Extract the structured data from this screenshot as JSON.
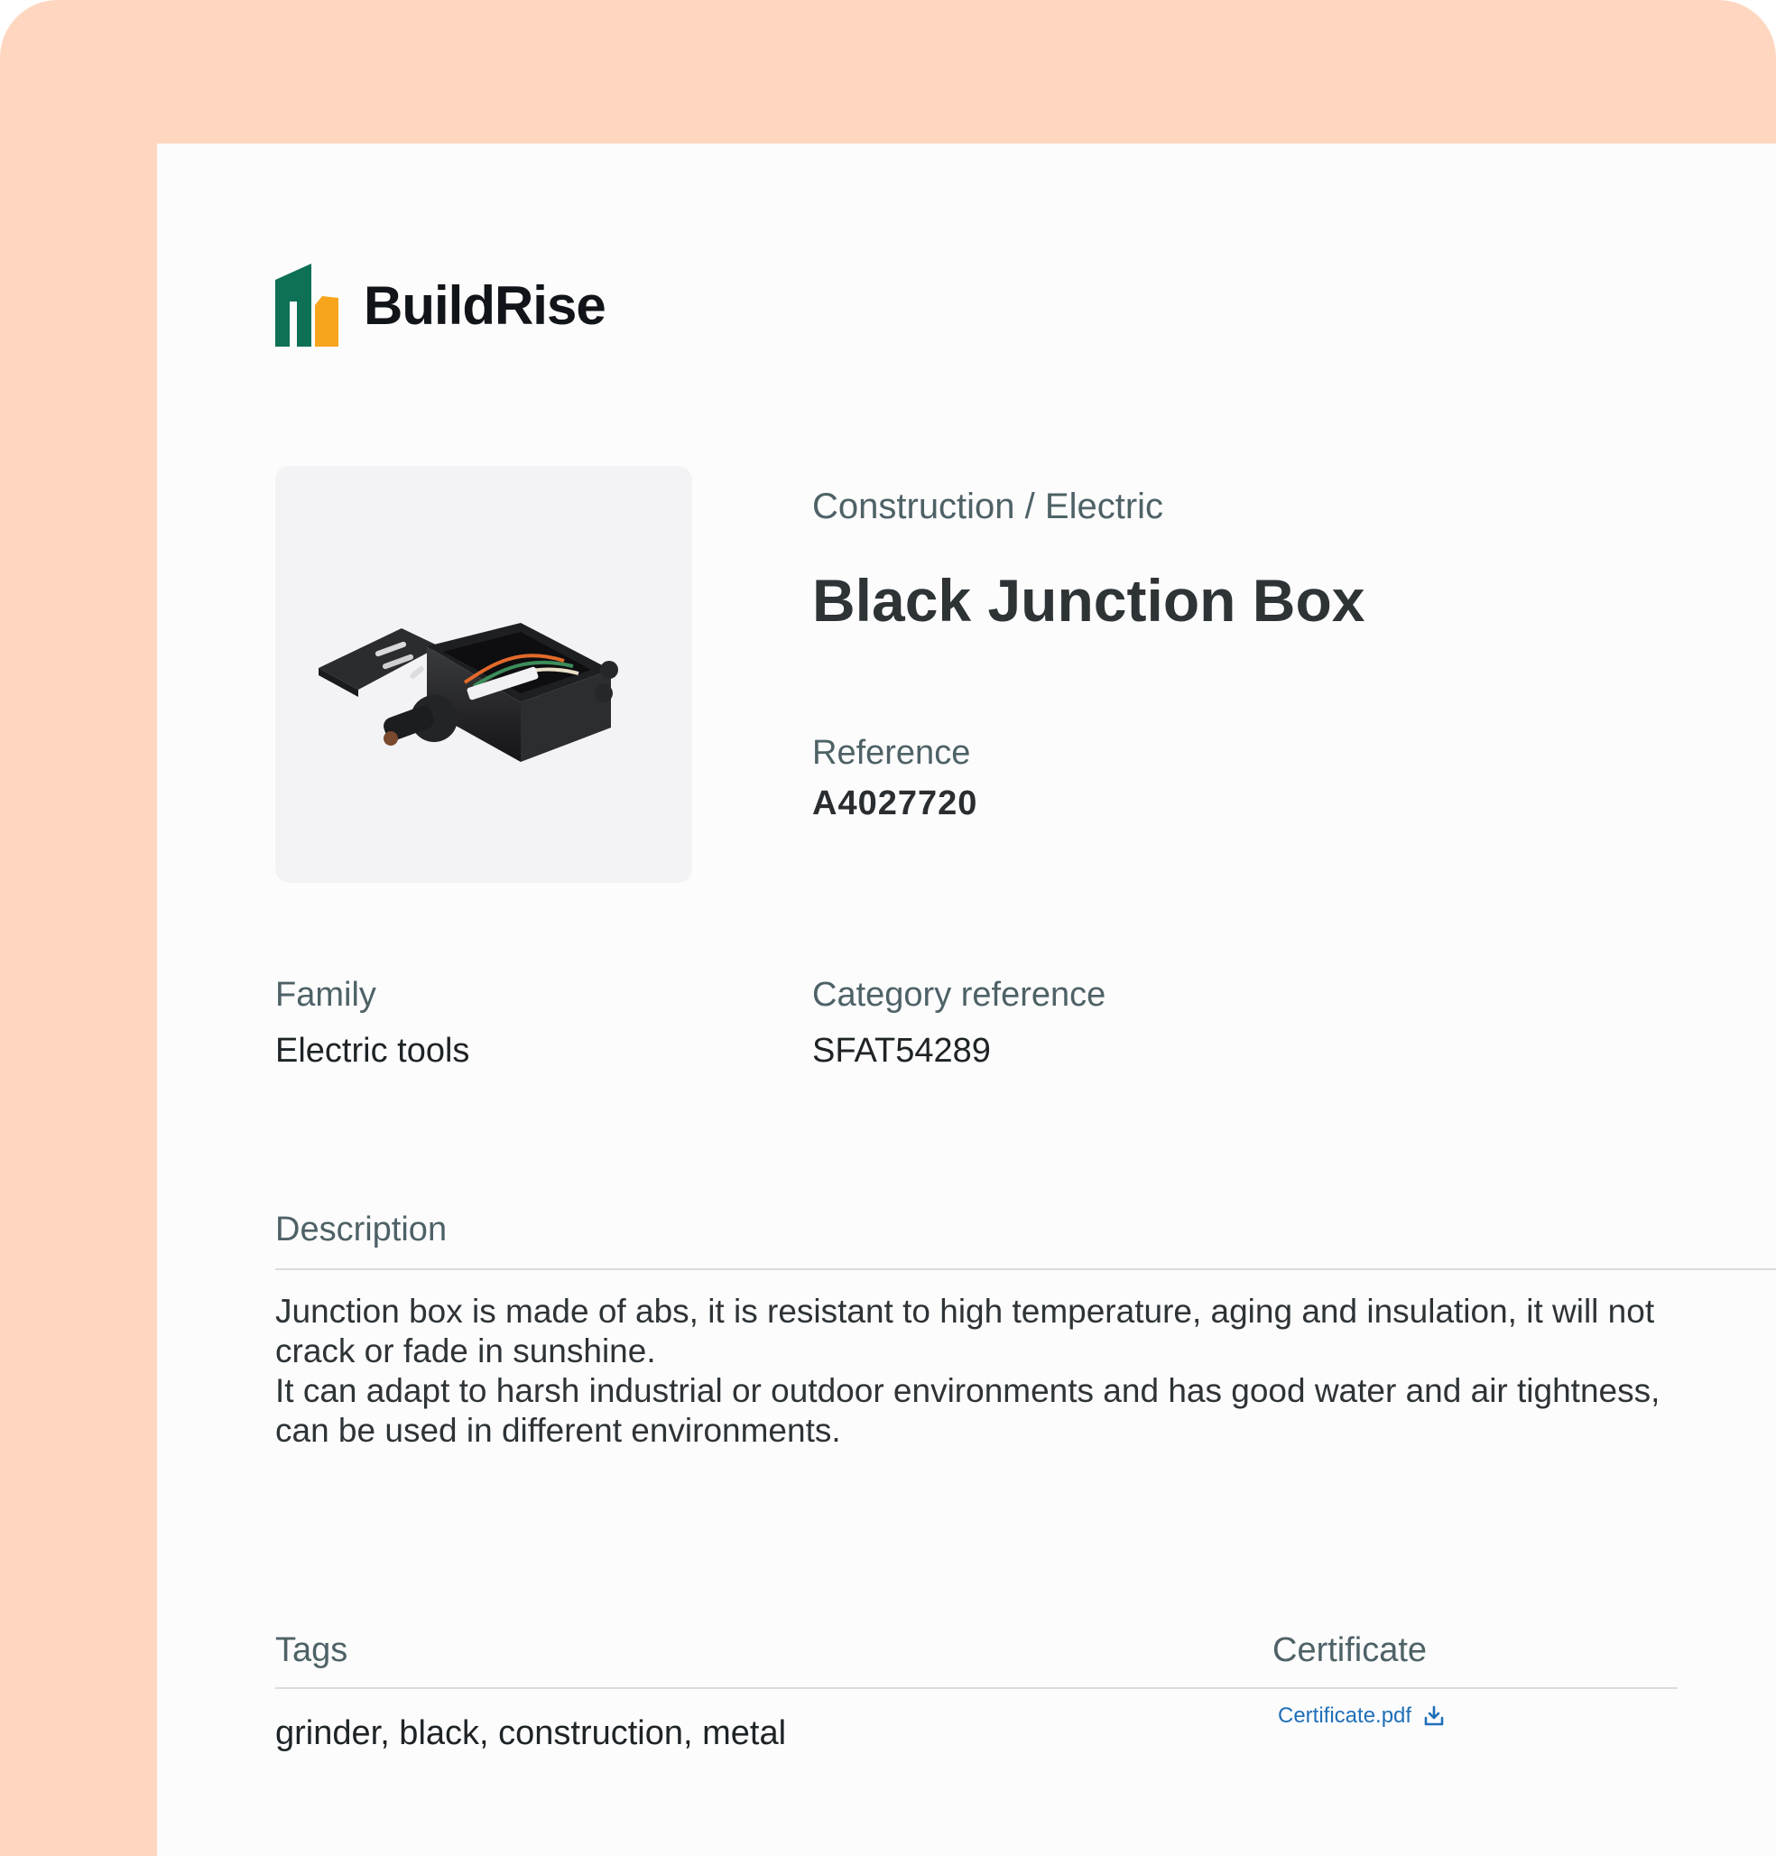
{
  "brand": {
    "name": "BuildRise",
    "colors": {
      "primary": "#0E7156",
      "accent": "#F7A51C",
      "frame": "#FFD6BF"
    },
    "icon": "buildrise-logo-icon"
  },
  "product": {
    "breadcrumb": "Construction / Electric",
    "title": "Black Junction Box",
    "image_icon": "junction-box-image",
    "reference_label": "Reference",
    "reference_value": "A4027720",
    "family_label": "Family",
    "family_value": "Electric tools",
    "category_reference_label": "Category reference",
    "category_reference_value": "SFAT54289",
    "description_label": "Description",
    "description_lines": [
      "Junction box is made of abs, it is resistant to high temperature, aging and insulation, it will not crack or fade in sunshine.",
      "It can adapt to harsh industrial or outdoor environments and has good water and air tightness, can be used in different environments."
    ],
    "tags_label": "Tags",
    "tags_value": "grinder, black, construction, metal",
    "certificate_label": "Certificate",
    "certificate_file": "Certificate.pdf",
    "certificate_icon": "download-icon"
  }
}
